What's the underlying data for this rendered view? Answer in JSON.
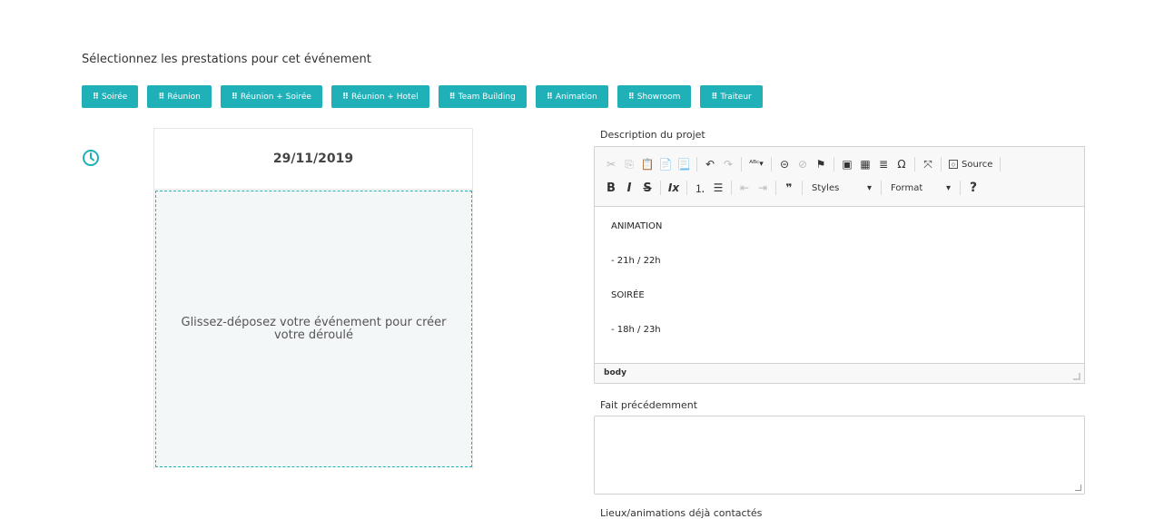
{
  "intro": "Sélectionnez les prestations pour cet événement",
  "buttons": [
    "Soirée",
    "Réunion",
    "Réunion + Soirée",
    "Réunion + Hotel",
    "Team Building",
    "Animation",
    "Showroom",
    "Traiteur"
  ],
  "button_grip": "⠿",
  "timeline": {
    "icon": "clock-icon",
    "date": "29/11/2019",
    "dropzone_text": "Glissez-déposez votre événement pour créer votre déroulé"
  },
  "description": {
    "label": "Description du projet",
    "toolbar": {
      "source_label": "Source",
      "styles_label": "Styles",
      "format_label": "Format",
      "bold": "B",
      "italic": "I",
      "strike": "S",
      "help": "?"
    },
    "content": [
      "ANIMATION",
      " - 21h / 22h",
      "SOIRÉE",
      "- 18h / 23h"
    ],
    "path": "body"
  },
  "previous": {
    "label": "Fait précédemment",
    "value": ""
  },
  "contacted": {
    "label": "Lieux/animations déjà contactés"
  },
  "colors": {
    "accent": "#1fb0b8"
  }
}
